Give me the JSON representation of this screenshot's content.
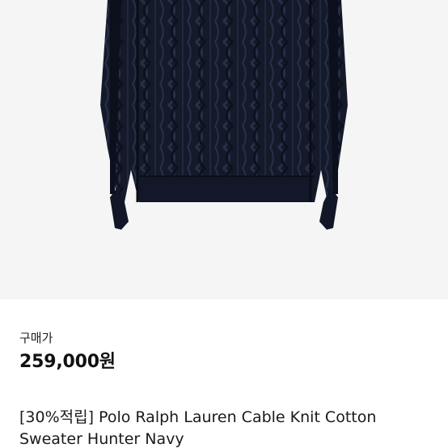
{
  "product": {
    "image": "navy-cable-knit-sweater",
    "image_background": "#f5f5f5",
    "sweater_color": "#151a2a"
  },
  "purchase": {
    "label": "구매가",
    "price": "259,000원"
  },
  "title": "[30%적립] Polo Ralph Lauren Cable Knit Cotton Sweater Hunter Navy"
}
